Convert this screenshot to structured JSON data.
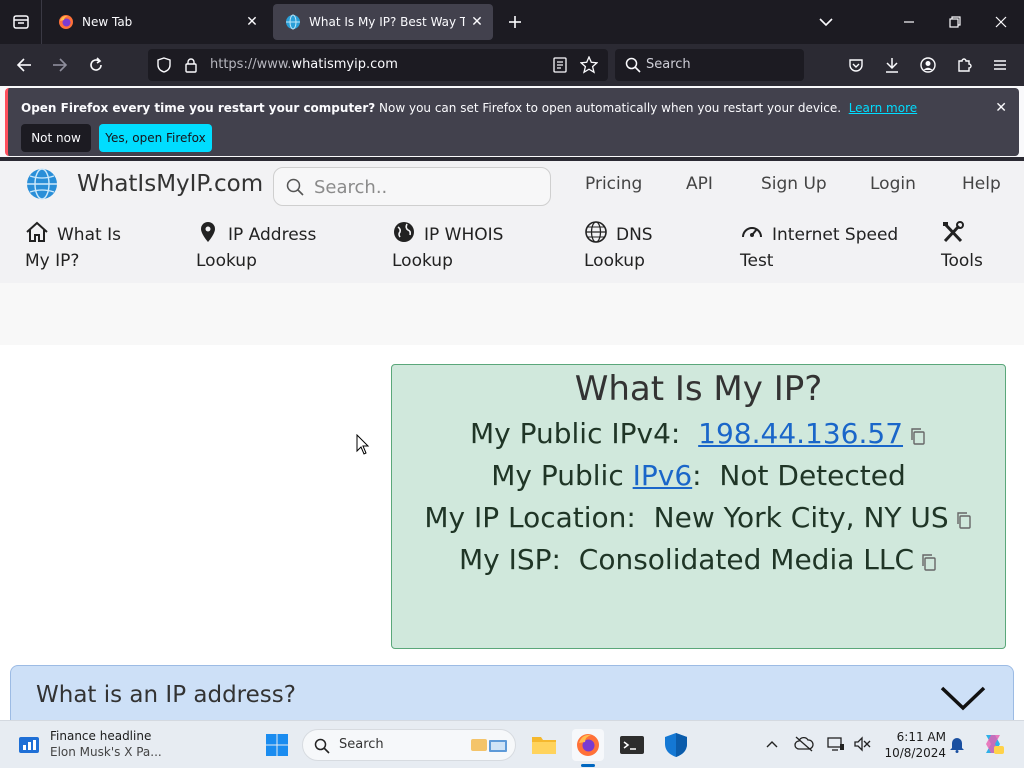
{
  "browser": {
    "tabs": [
      {
        "title": "New Tab",
        "active": false
      },
      {
        "title": "What Is My IP? Best Way To Check Your Public IP Address",
        "active": true
      }
    ],
    "url_prefix": "https://www.",
    "url_domain": "whatismyip.com",
    "search_placeholder": "Search"
  },
  "notification": {
    "bold": "Open Firefox every time you restart your computer?",
    "text": " Now you can set Firefox to open automatically when you restart your device.",
    "learn_more": "Learn more",
    "not_now": "Not now",
    "yes_open": "Yes, open Firefox"
  },
  "site": {
    "logo": "WhatIsMyIP.com",
    "search_placeholder": "Search..",
    "top_links": [
      "Pricing",
      "API",
      "Sign Up",
      "Login",
      "Help"
    ],
    "main_nav": [
      {
        "line1": "What Is",
        "line2": "My IP?",
        "icon": "home-icon"
      },
      {
        "line1": "IP Address",
        "line2": "Lookup",
        "icon": "map-pin-icon"
      },
      {
        "line1": "IP WHOIS",
        "line2": "Lookup",
        "icon": "globe-icon"
      },
      {
        "line1": "DNS",
        "line2": "Lookup",
        "icon": "dns-globe-icon"
      },
      {
        "line1": "Internet Speed",
        "line2": "Test",
        "icon": "speedometer-icon"
      },
      {
        "line1": "",
        "line2": "Tools",
        "icon": "tools-icon"
      }
    ]
  },
  "ipbox": {
    "heading": "What Is My IP?",
    "ipv4_label": "My Public IPv4:",
    "ipv4_value": "198.44.136.57",
    "ipv6_label_pre": "My Public",
    "ipv6_link": "IPv6",
    "ipv6_label_post": ":",
    "ipv6_value": "Not Detected",
    "location_label": "My IP Location:",
    "location_value": "New York City, NY US",
    "isp_label": "My ISP:",
    "isp_value": "Consolidated Media LLC"
  },
  "faq": {
    "question": "What is an IP address?"
  },
  "taskbar": {
    "widget_title": "Finance headline",
    "widget_text": "Elon Musk's X Pa...",
    "search_label": "Search",
    "time": "6:11 AM",
    "date": "10/8/2024"
  },
  "colors": {
    "ipbox_bg": "#d0e8dc",
    "accordion_bg": "#cde0f7",
    "link": "#1a66c9",
    "accent_button": "#00ddff"
  }
}
